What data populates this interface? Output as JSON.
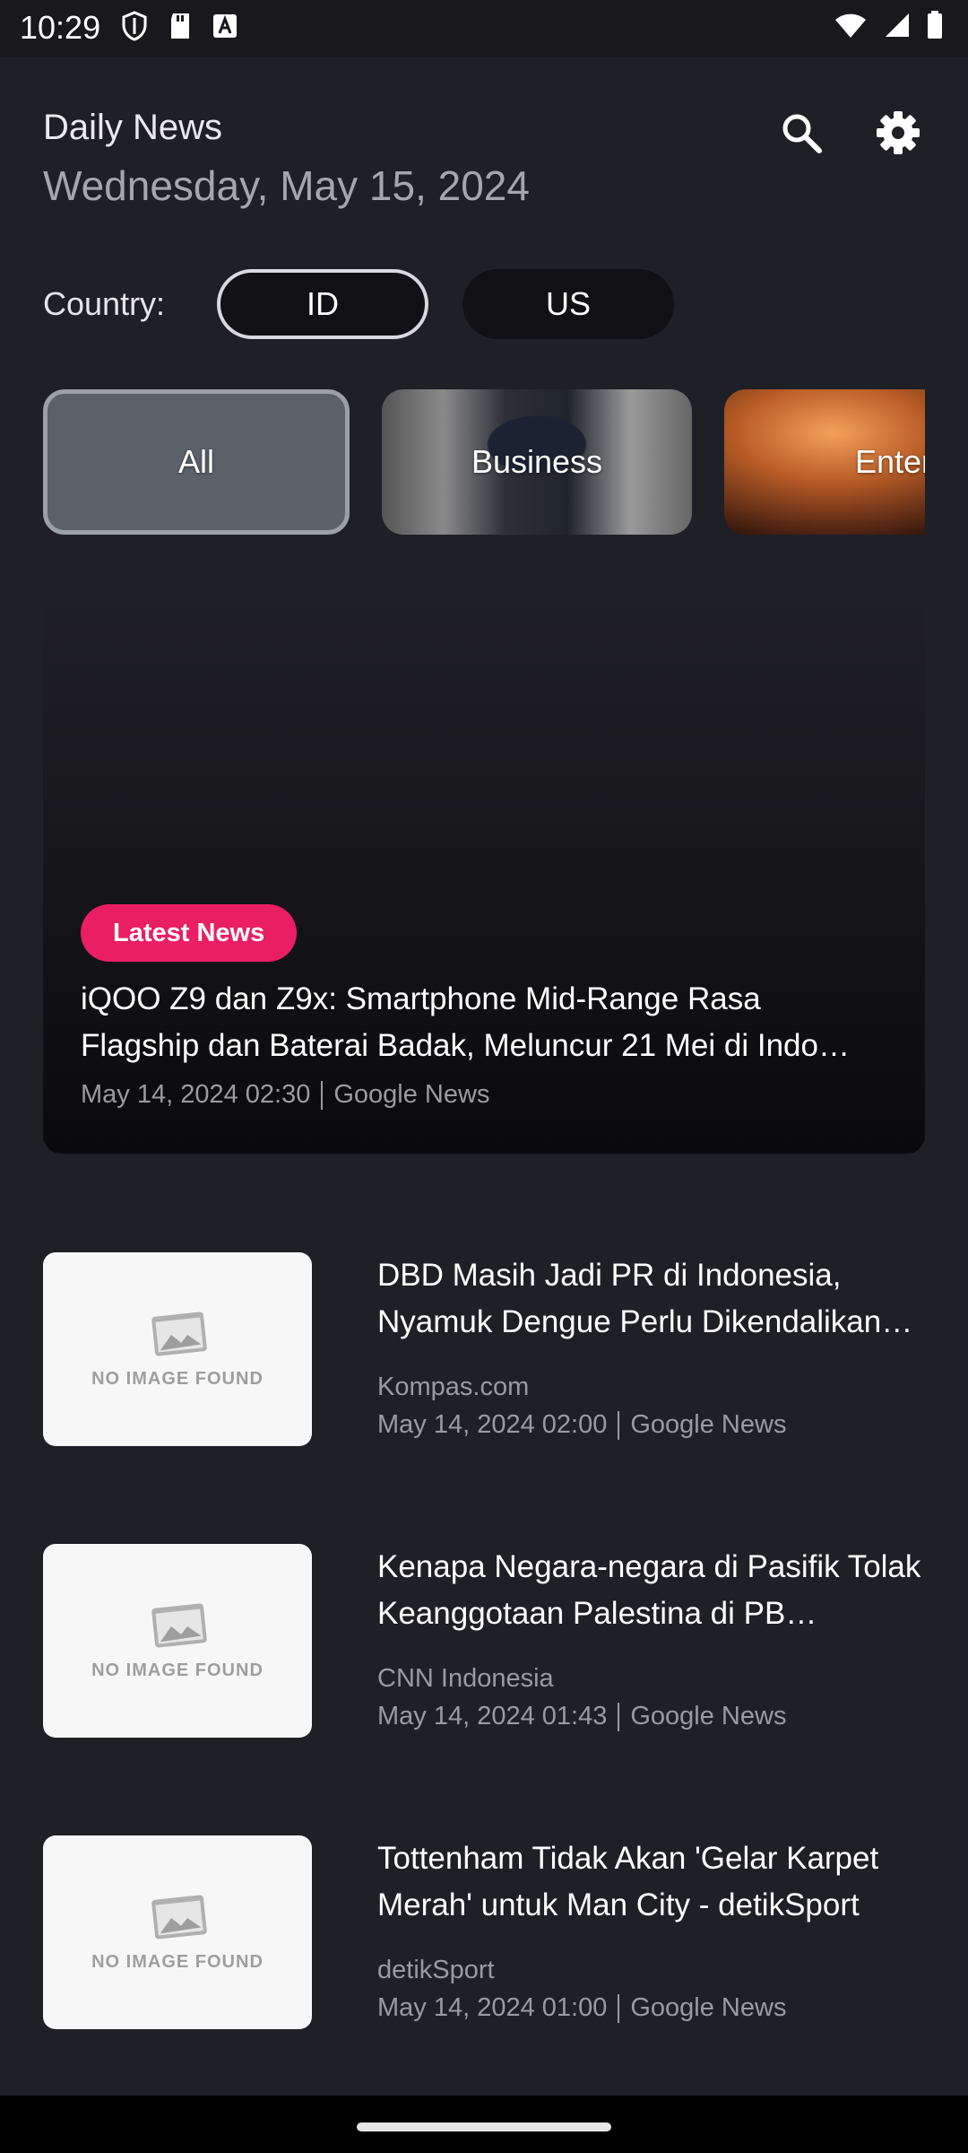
{
  "status_bar": {
    "time": "10:29"
  },
  "header": {
    "title": "Daily News",
    "date": "Wednesday, May 15, 2024"
  },
  "country": {
    "label": "Country:",
    "options": [
      "ID",
      "US"
    ],
    "selected": "ID"
  },
  "categories": [
    {
      "label": "All",
      "selected": true
    },
    {
      "label": "Business",
      "selected": false
    },
    {
      "label": "Entertai",
      "selected": false
    }
  ],
  "featured": {
    "badge": "Latest News",
    "title": "iQOO Z9 dan Z9x: Smartphone Mid-Range Rasa Flagship dan Baterai Badak, Meluncur 21 Mei di Indo…",
    "date": "May 14, 2024 02:30",
    "source": "Google News"
  },
  "news": [
    {
      "title": "DBD Masih Jadi PR di Indonesia, Nyamuk Dengue Perlu Dikendalikan…",
      "publisher": "Kompas.com",
      "date": "May 14, 2024 02:00",
      "source": "Google News",
      "thumbnail_text": "NO IMAGE FOUND"
    },
    {
      "title": "Kenapa Negara-negara di Pasifik Tolak Keanggotaan Palestina di PB…",
      "publisher": "CNN Indonesia",
      "date": "May 14, 2024 01:43",
      "source": "Google News",
      "thumbnail_text": "NO IMAGE FOUND"
    },
    {
      "title": "Tottenham Tidak Akan 'Gelar Karpet Merah' untuk Man City - detikSport",
      "publisher": "detikSport",
      "date": "May 14, 2024 01:00",
      "source": "Google News",
      "thumbnail_text": "NO IMAGE FOUND"
    }
  ],
  "colors": {
    "background": "#1f1f26",
    "accent": "#e91e63",
    "muted_text": "#9a9aa2"
  }
}
